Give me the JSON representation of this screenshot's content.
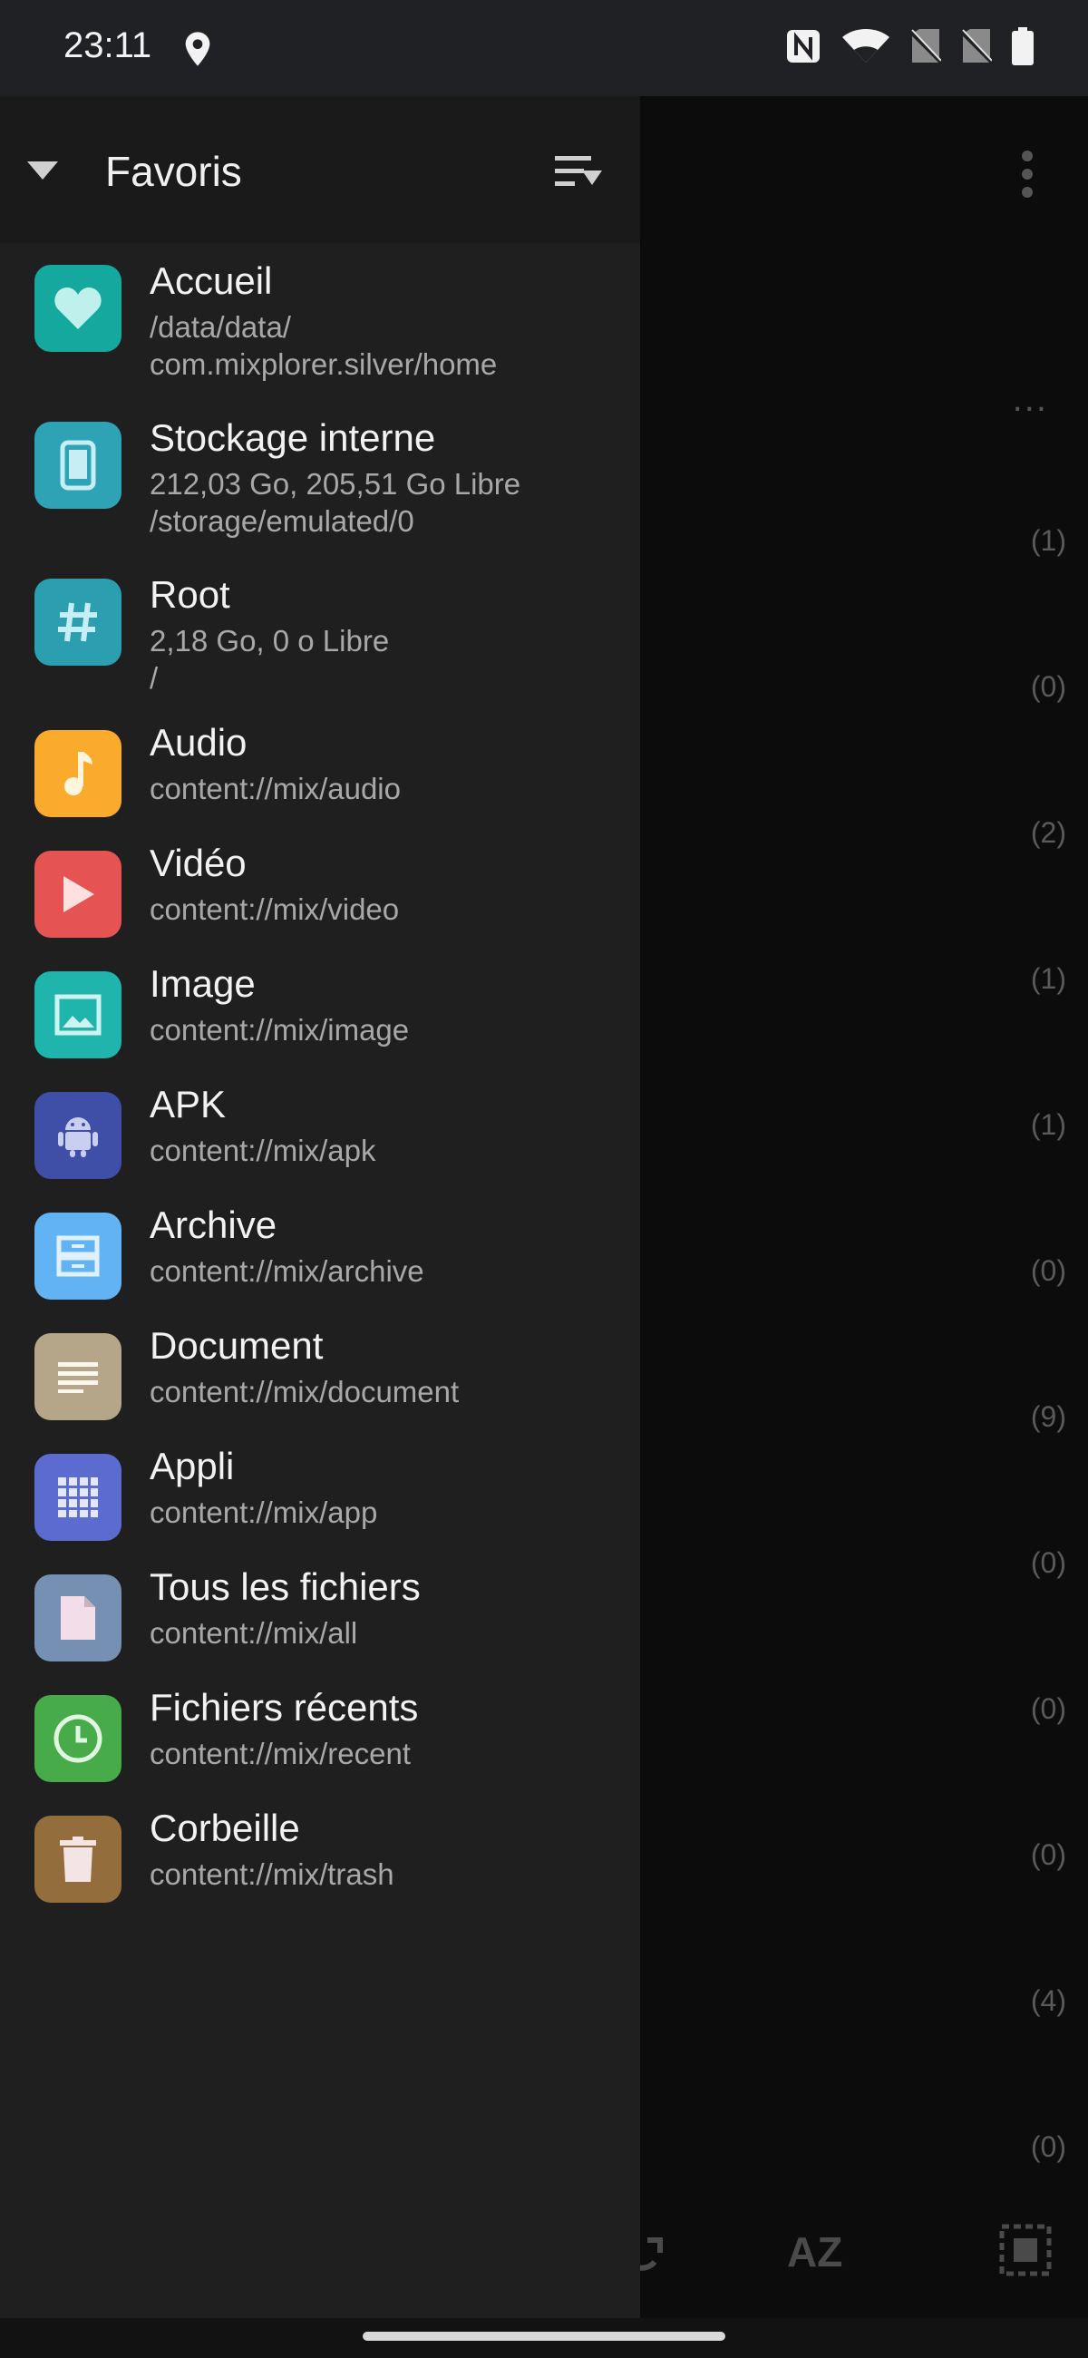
{
  "status_bar": {
    "time": "23:11"
  },
  "drawer": {
    "title": "Favoris",
    "items": [
      {
        "name": "Accueil",
        "line1": "/data/data/",
        "line2": "com.mixplorer.silver/home",
        "icon": "heart-icon",
        "color": "#14a89f"
      },
      {
        "name": "Stockage interne",
        "line1": "212,03 Go,  205,51 Go Libre",
        "line2": "/storage/emulated/0",
        "icon": "phone-icon",
        "color": "#2fa3b6"
      },
      {
        "name": "Root",
        "line1": "2,18 Go,  0 o Libre",
        "line2": "/",
        "icon": "hash-icon",
        "color": "#2b9fb0"
      },
      {
        "name": "Audio",
        "line1": "content://mix/audio",
        "icon": "music-note-icon",
        "color": "#fbab2c"
      },
      {
        "name": "Vidéo",
        "line1": "content://mix/video",
        "icon": "play-icon",
        "color": "#e55353"
      },
      {
        "name": "Image",
        "line1": "content://mix/image",
        "icon": "image-icon",
        "color": "#1fb5ad"
      },
      {
        "name": "APK",
        "line1": "content://mix/apk",
        "icon": "android-icon",
        "color": "#3f4fa8"
      },
      {
        "name": "Archive",
        "line1": "content://mix/archive",
        "icon": "archive-icon",
        "color": "#62b3f4"
      },
      {
        "name": "Document",
        "line1": "content://mix/document",
        "icon": "document-icon",
        "color": "#b5a68a"
      },
      {
        "name": "Appli",
        "line1": "content://mix/app",
        "icon": "apps-grid-icon",
        "color": "#5c6bd0"
      },
      {
        "name": "Tous les fichiers",
        "line1": "content://mix/all",
        "icon": "file-icon",
        "color": "#7590b2"
      },
      {
        "name": "Fichiers récents",
        "line1": "content://mix/recent",
        "icon": "clock-icon",
        "color": "#46ab48"
      },
      {
        "name": "Corbeille",
        "line1": "content://mix/trash",
        "icon": "trash-icon",
        "color": "#946d3c"
      }
    ]
  },
  "background": {
    "more": "...",
    "counts": [
      "(1)",
      "(0)",
      "(2)",
      "(1)",
      "(1)",
      "(0)",
      "(9)",
      "(0)",
      "(0)",
      "(0)",
      "(4)",
      "(0)"
    ],
    "sort_label": "AZ"
  }
}
